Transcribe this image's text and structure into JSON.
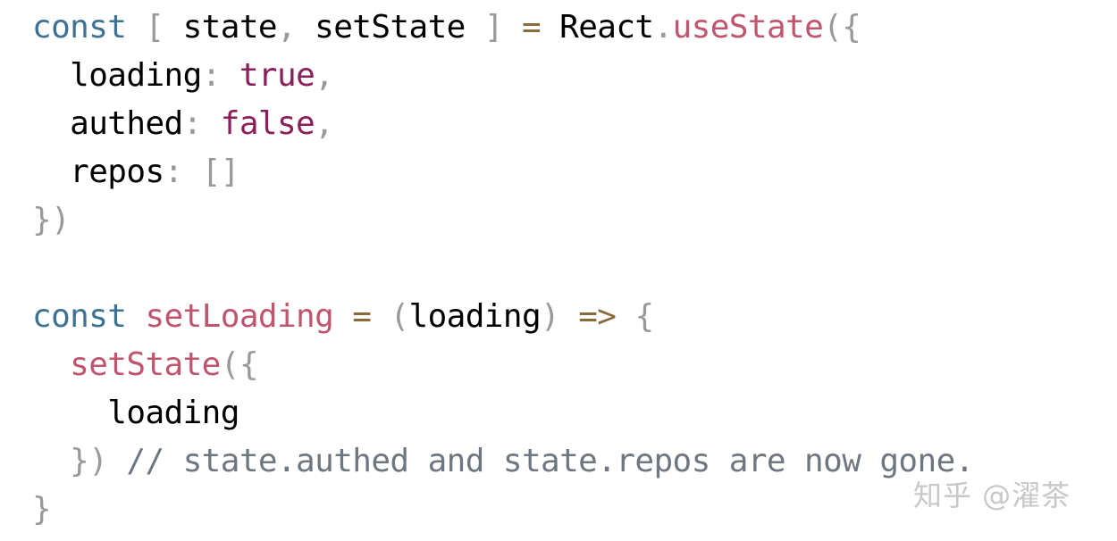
{
  "colors": {
    "keyword": "#3e7294",
    "function": "#c0566e",
    "boolean": "#8b1f5a",
    "punctuation": "#999999",
    "operator": "#8a6a3b",
    "comment": "#6e7781",
    "identifier": "#000000"
  },
  "code": {
    "l1": {
      "kw": "const",
      "sp1": " ",
      "open": "[",
      "sp2": " ",
      "a": "state",
      "comma": ",",
      "sp3": " ",
      "b": "setState",
      "sp4": " ",
      "close": "]",
      "sp5": " ",
      "eq": "=",
      "sp6": " ",
      "obj": "React",
      "dot": ".",
      "fn": "useState",
      "paren": "(",
      "brace": "{"
    },
    "l2": {
      "indent": "  ",
      "key": "loading",
      "colon": ":",
      "sp": " ",
      "val": "true",
      "comma": ","
    },
    "l3": {
      "indent": "  ",
      "key": "authed",
      "colon": ":",
      "sp": " ",
      "val": "false",
      "comma": ","
    },
    "l4": {
      "indent": "  ",
      "key": "repos",
      "colon": ":",
      "sp": " ",
      "val": "[]"
    },
    "l5": {
      "close": "})"
    },
    "l6": {
      "blank": " "
    },
    "l7": {
      "kw": "const",
      "sp1": " ",
      "fn": "setLoading",
      "sp2": " ",
      "eq": "=",
      "sp3": " ",
      "open": "(",
      "param": "loading",
      "close": ")",
      "sp4": " ",
      "arrow": "=>",
      "sp5": " ",
      "brace": "{"
    },
    "l8": {
      "indent": "  ",
      "fn": "setState",
      "paren": "(",
      "brace": "{"
    },
    "l9": {
      "indent": "    ",
      "ident": "loading"
    },
    "l10": {
      "indent": "  ",
      "close": "})",
      "sp": " ",
      "comment": "// state.authed and state.repos are now gone."
    },
    "l11": {
      "close": "}"
    }
  },
  "watermark": "知乎 @濯茶"
}
